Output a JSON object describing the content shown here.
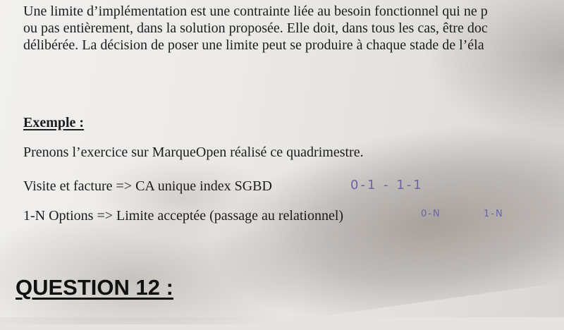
{
  "paragraph": {
    "line1": "Une limite d’implémentation est une contrainte liée au besoin fonctionnel qui ne p",
    "line2": "ou pas entièrement, dans la solution proposée. Elle doit, dans tous les cas, être doc",
    "line3": "délibérée. La décision de poser une limite peut se produire à chaque stade de l’éla"
  },
  "example": {
    "heading": "Exemple :",
    "line1": "Prenons l’exercice sur MarqueOpen réalisé ce quadrimestre.",
    "line2": "Visite et facture => CA unique index SGBD",
    "line3": "1-N Options => Limite acceptée (passage au relationnel)"
  },
  "annotations": {
    "note1": "0-1 - 1-1",
    "note2": "0-N",
    "note3": "1-N"
  },
  "question": {
    "heading": "QUESTION 12 :"
  },
  "colors": {
    "ink": "#1c1c1c",
    "handwriting": "#6a63a8",
    "paper": "#eceae7"
  }
}
